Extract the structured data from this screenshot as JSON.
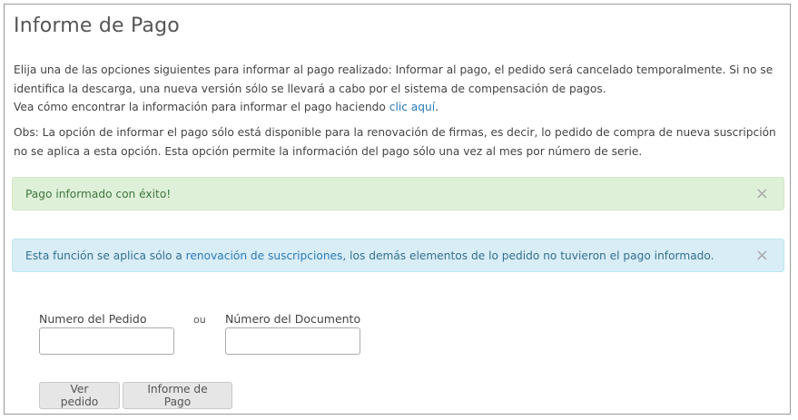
{
  "page": {
    "title": "Informe de Pago"
  },
  "intro": {
    "line1": "Elija una de las opciones siguientes para informar al pago realizado: Informar al pago, el pedido será cancelado temporalmente. Si no se identifica la descarga, una nueva versión sólo se llevará a cabo por el sistema de compensación de pagos.",
    "line2_prefix": "Vea cómo encontrar la información para informar el pago haciendo ",
    "line2_link": "clic aquí",
    "line2_suffix": "."
  },
  "obs": {
    "text": "Obs: La opción de informar el pago sólo está disponible para la renovación de firmas, es decir, lo pedido de compra de nueva suscripción no se aplica a esta opción. Esta opción permite la información del pago sólo una vez al mes por número de serie."
  },
  "alerts": {
    "success": {
      "text": "Pago informado con éxito!",
      "close": "×"
    },
    "info": {
      "prefix": "Esta función se aplica sólo a ",
      "link": "renovación de suscripciones",
      "suffix": ", los demás elementos de lo pedido no tuvieron el pago informado.",
      "close": "×"
    }
  },
  "form": {
    "pedido_label": "Numero del Pedido",
    "pedido_value": "",
    "or_label": "ou",
    "documento_label": "Número del Documento",
    "documento_value": ""
  },
  "buttons": {
    "ver_pedido": "Ver pedido",
    "informe_pago": "Informe de Pago"
  },
  "colors": {
    "success_bg": "#dff0d8",
    "success_text": "#3c763d",
    "info_bg": "#d9edf7",
    "info_text": "#31708f",
    "link": "#2a7ab9"
  }
}
